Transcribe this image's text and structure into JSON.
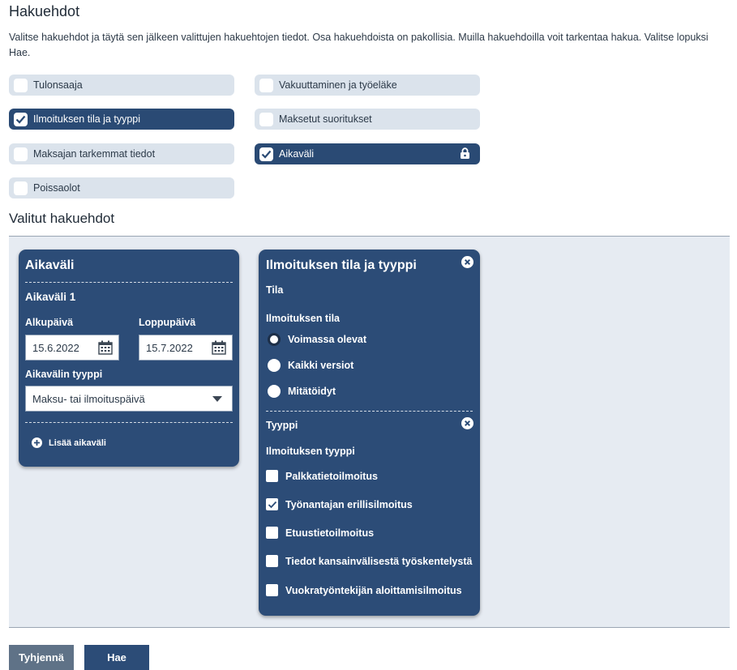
{
  "heading": "Hakuehdot",
  "intro": "Valitse hakuehdot ja täytä sen jälkeen valittujen hakuehtojen tiedot. Osa hakuehdoista on pakollisia. Muilla hakuehdoilla voit tarkentaa hakua. Valitse lopuksi Hae.",
  "criteria": [
    {
      "label": "Tulonsaaja",
      "checked": false
    },
    {
      "label": "Vakuuttaminen ja työeläke",
      "checked": false
    },
    {
      "label": "Ilmoituksen tila ja tyyppi",
      "checked": true
    },
    {
      "label": "Maksetut suoritukset",
      "checked": false
    },
    {
      "label": "Maksajan tarkemmat tiedot",
      "checked": false
    },
    {
      "label": "Aikaväli",
      "checked": true,
      "locked": true
    },
    {
      "label": "Poissaolot",
      "checked": false
    }
  ],
  "selected_heading": "Valitut hakuehdot",
  "period_card": {
    "title": "Aikaväli",
    "subtitle": "Aikaväli 1",
    "start_label": "Alkupäivä",
    "start_value": "15.6.2022",
    "end_label": "Loppupäivä",
    "end_value": "15.7.2022",
    "type_label": "Aikavälin tyyppi",
    "type_value": "Maksu- tai ilmoituspäivä",
    "add_label": "Lisää aikaväli"
  },
  "status_card": {
    "title": "Ilmoituksen tila ja tyyppi",
    "state_heading": "Tila",
    "state_label": "Ilmoituksen tila",
    "state_options": [
      {
        "label": "Voimassa olevat",
        "selected": true
      },
      {
        "label": "Kaikki versiot",
        "selected": false
      },
      {
        "label": "Mitätöidyt",
        "selected": false
      }
    ],
    "type_heading": "Tyyppi",
    "type_label": "Ilmoituksen tyyppi",
    "type_options": [
      {
        "label": "Palkkatietoilmoitus",
        "checked": false
      },
      {
        "label": "Työnantajan erillisilmoitus",
        "checked": true
      },
      {
        "label": "Etuustietoilmoitus",
        "checked": false
      },
      {
        "label": "Tiedot kansainvälisestä työskentelystä",
        "checked": false
      },
      {
        "label": "Vuokratyöntekijän aloittamisilmoitus",
        "checked": false
      }
    ]
  },
  "buttons": {
    "clear": "Tyhjennä",
    "search": "Hae"
  },
  "colors": {
    "primary": "#2c4c77",
    "chip_bg": "#dbe3ec",
    "panel_bg": "#e6ebf2",
    "clear_btn": "#5f7287"
  }
}
